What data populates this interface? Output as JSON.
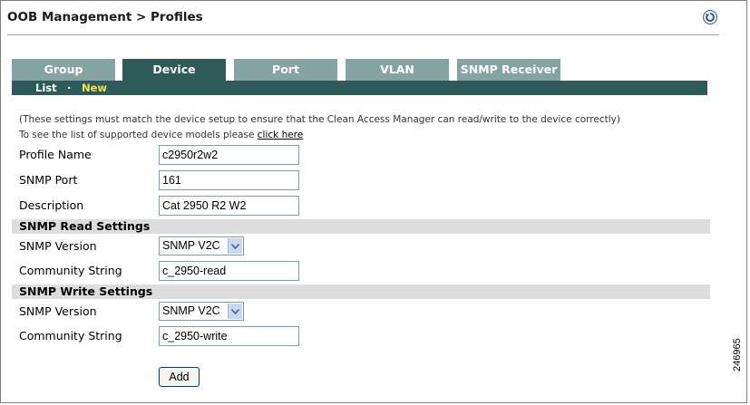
{
  "header": {
    "title": "OOB Management > Profiles"
  },
  "tabs": [
    {
      "label": "Group",
      "active": false
    },
    {
      "label": "Device",
      "active": true
    },
    {
      "label": "Port",
      "active": false
    },
    {
      "label": "VLAN",
      "active": false
    },
    {
      "label": "SNMP Receiver",
      "active": false
    }
  ],
  "subnav": {
    "list": "List",
    "separator": "·",
    "new": "New"
  },
  "notes": {
    "settings": "(These settings must match the device setup to ensure that the Clean Access Manager can read/write to the device correctly)",
    "models_prefix": "To see the list of supported device models please ",
    "models_link": "click here"
  },
  "form": {
    "profile_name": {
      "label": "Profile Name",
      "value": "c2950r2w2"
    },
    "snmp_port": {
      "label": "SNMP Port",
      "value": "161"
    },
    "description": {
      "label": "Description",
      "value": "Cat 2950 R2 W2"
    }
  },
  "read_settings": {
    "heading": "SNMP Read Settings",
    "version_label": "SNMP Version",
    "version_value": "SNMP V2C",
    "community_label": "Community String",
    "community_value": "c_2950-read"
  },
  "write_settings": {
    "heading": "SNMP Write Settings",
    "version_label": "SNMP Version",
    "version_value": "SNMP V2C",
    "community_label": "Community String",
    "community_value": "c_2950-write"
  },
  "add_label": "Add",
  "figure_id": "246965",
  "colors": {
    "tab_active": "#2e5a5a",
    "tab_inactive": "#85a3a3",
    "new_link": "#f2e34a",
    "section_bg": "#dddddd"
  },
  "icons": {
    "refresh": "refresh-icon",
    "dropdown": "chevron-down-icon"
  }
}
